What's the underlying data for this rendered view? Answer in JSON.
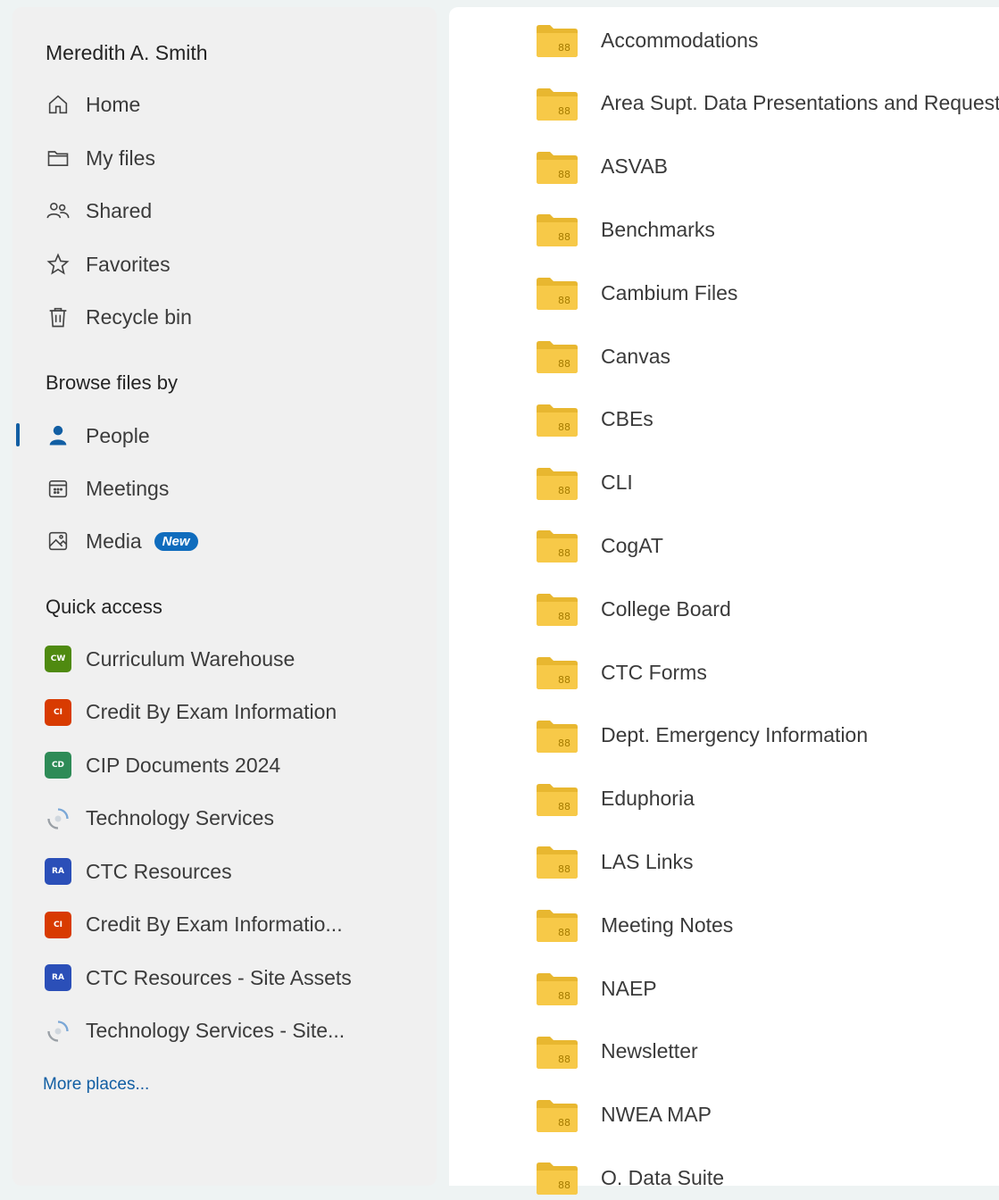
{
  "user": {
    "name": "Meredith A. Smith"
  },
  "nav": [
    {
      "label": "Home",
      "icon": "home-icon"
    },
    {
      "label": "My files",
      "icon": "folder-icon"
    },
    {
      "label": "Shared",
      "icon": "people-icon"
    },
    {
      "label": "Favorites",
      "icon": "star-icon"
    },
    {
      "label": "Recycle bin",
      "icon": "trash-icon"
    }
  ],
  "browse": {
    "heading": "Browse files by",
    "items": [
      {
        "label": "People",
        "icon": "person-icon",
        "active": true
      },
      {
        "label": "Meetings",
        "icon": "calendar-icon"
      },
      {
        "label": "Media",
        "icon": "image-icon",
        "badge": "New"
      }
    ]
  },
  "quick_access": {
    "heading": "Quick access",
    "items": [
      {
        "label": "Curriculum Warehouse",
        "icon_text": "CW",
        "color": "#4f8a10"
      },
      {
        "label": "Credit By Exam Information",
        "icon_text": "CI",
        "color": "#d83b01"
      },
      {
        "label": "CIP Documents 2024",
        "icon_text": "CD",
        "color": "#2e8b57"
      },
      {
        "label": "Technology Services",
        "icon_text": "",
        "color": "#ffffff"
      },
      {
        "label": "CTC Resources",
        "icon_text": "RA",
        "color": "#2b4fb8"
      },
      {
        "label": "Credit By Exam Informatio...",
        "icon_text": "CI",
        "color": "#d83b01"
      },
      {
        "label": "CTC Resources - Site Assets",
        "icon_text": "RA",
        "color": "#2b4fb8"
      },
      {
        "label": "Technology Services - Site...",
        "icon_text": "",
        "color": "#ffffff"
      }
    ],
    "more": "More places..."
  },
  "folders": [
    "Accommodations",
    "Area Supt. Data Presentations and Requests",
    "ASVAB",
    "Benchmarks",
    "Cambium Files",
    "Canvas",
    "CBEs",
    "CLI",
    "CogAT",
    "College Board",
    "CTC Forms",
    "Dept. Emergency Information",
    "Eduphoria",
    "LAS Links",
    "Meeting Notes",
    "NAEP",
    "Newsletter",
    "NWEA MAP",
    "O. Data Suite"
  ],
  "colors": {
    "accent": "#115ea3",
    "folder": "#f7c948",
    "badge": "#0f6cbd"
  }
}
